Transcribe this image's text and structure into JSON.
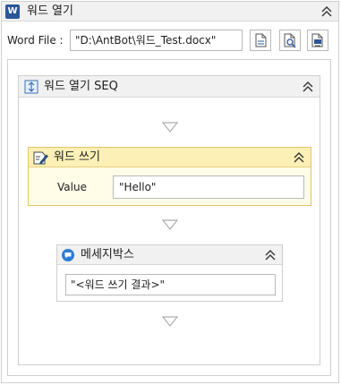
{
  "word_open": {
    "title": "워드 열기",
    "icon": "word-icon",
    "icon_letter": "W",
    "word_file_label": "Word File :",
    "word_file_value": "\"D:\\AntBot\\워드_Test.docx\"",
    "buttons": [
      "open-file-icon",
      "browse-file-icon",
      "settings-file-icon"
    ]
  },
  "sequence": {
    "title": "워드 열기 SEQ",
    "icon": "sequence-icon"
  },
  "word_write": {
    "title": "워드 쓰기",
    "icon": "edit-document-icon",
    "value_label": "Value",
    "value": "\"Hello\""
  },
  "message_box": {
    "title": "메세지박스",
    "icon": "message-icon",
    "value": "\"<워드 쓰기 결과>\""
  },
  "colors": {
    "word_blue": "#2b579a",
    "highlight_header": "#fdf0b6",
    "highlight_border": "#e5c365",
    "message_icon": "#2a7dd4"
  }
}
